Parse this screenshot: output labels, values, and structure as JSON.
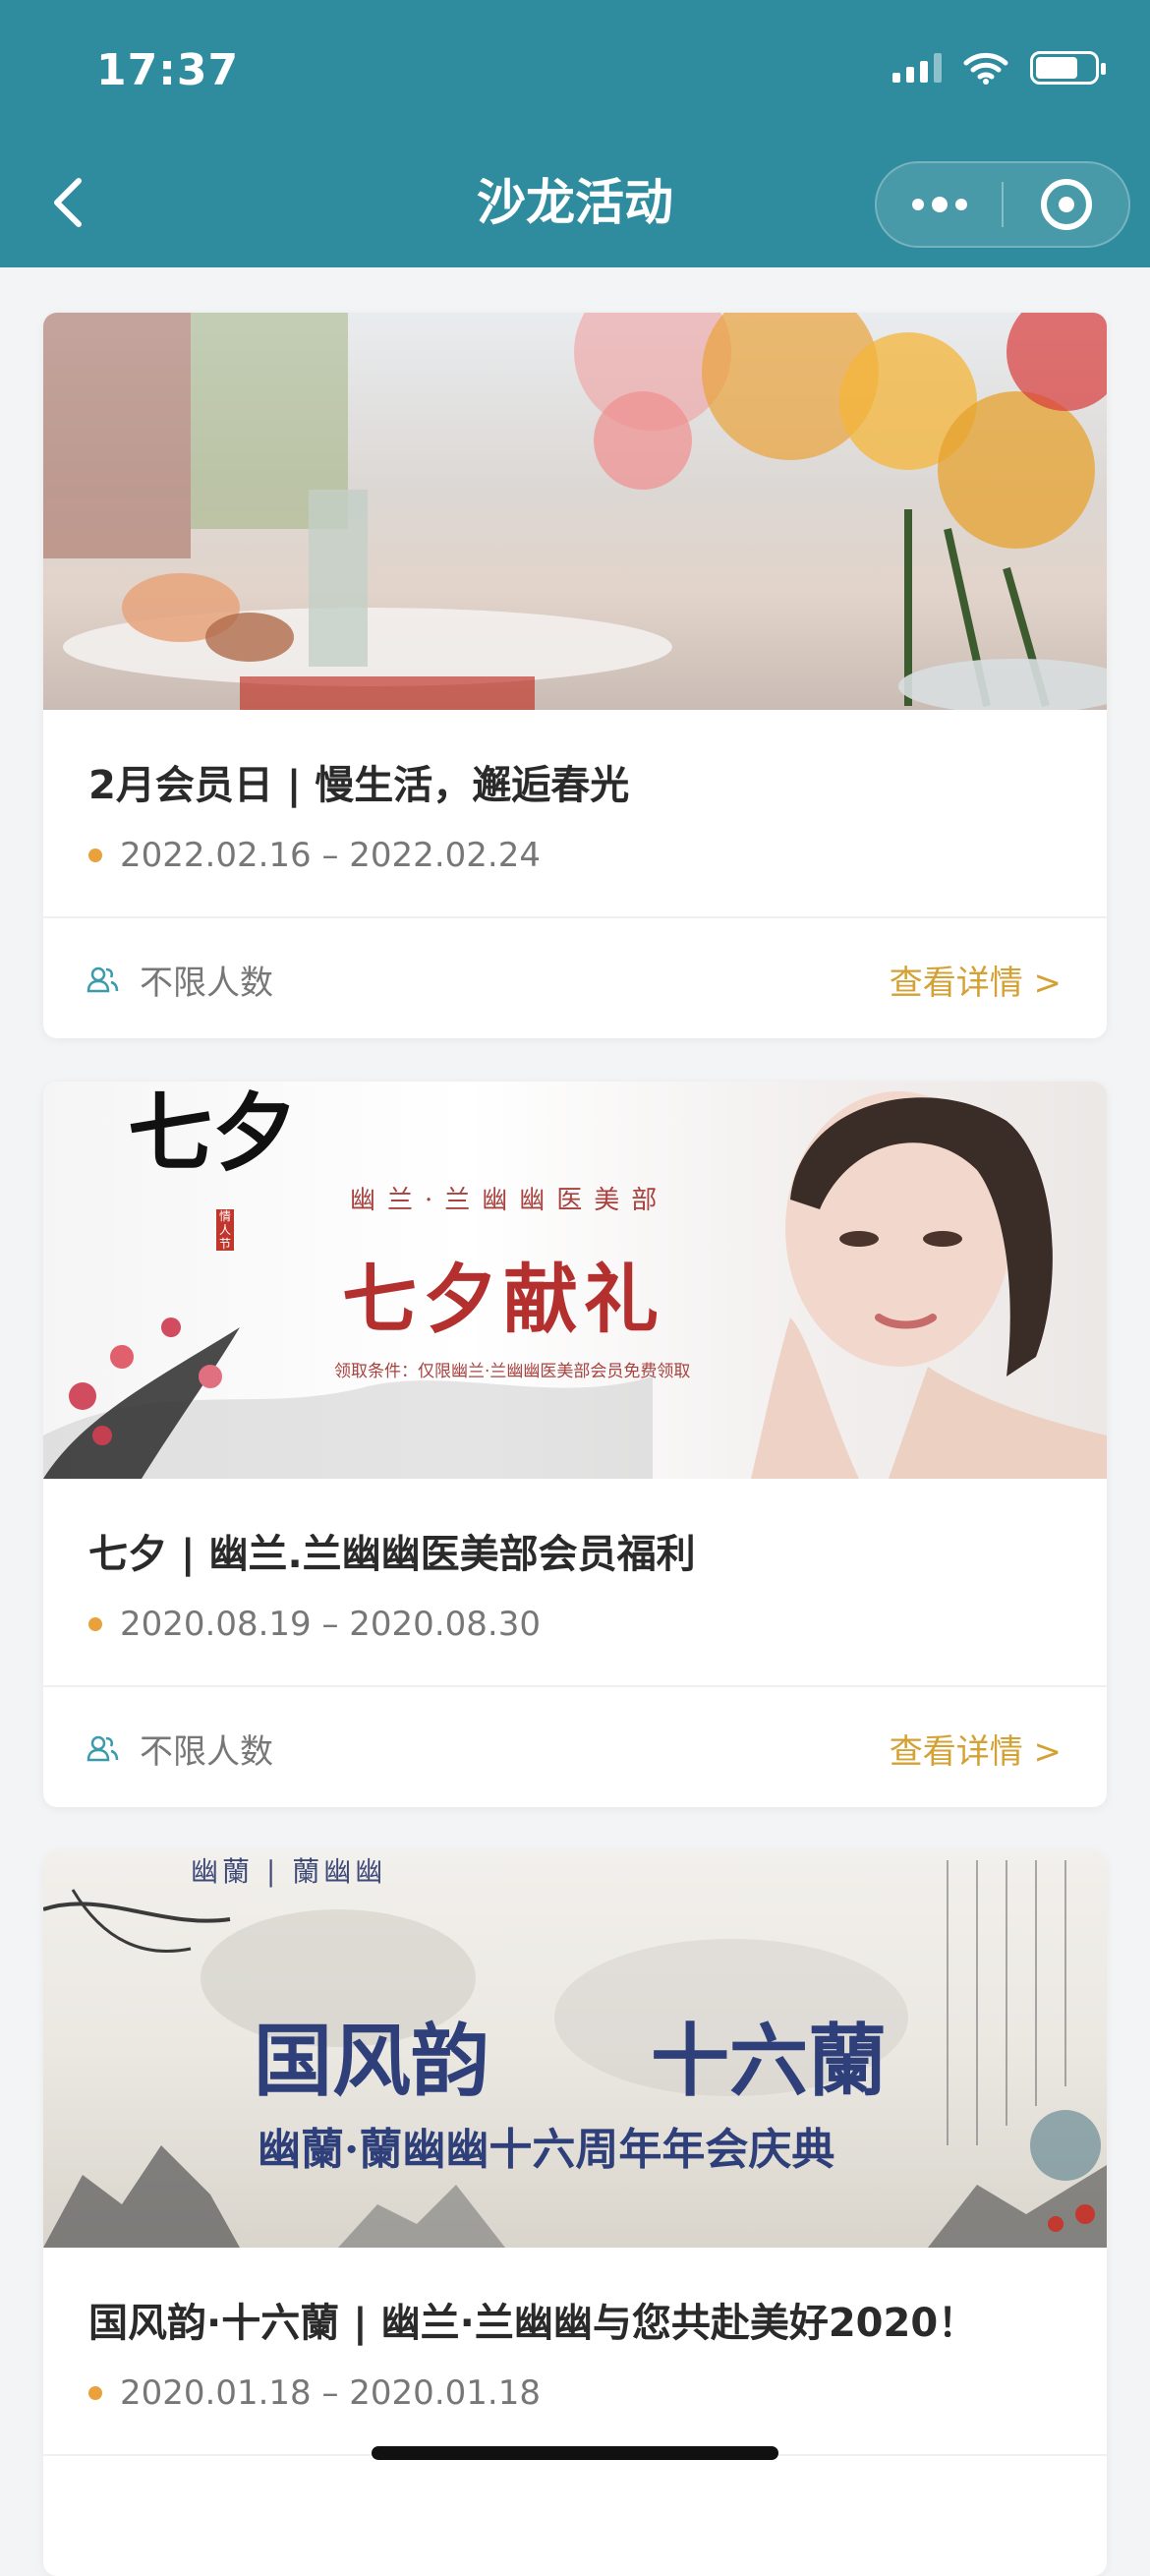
{
  "status_bar": {
    "time": "17:37"
  },
  "nav": {
    "title": "沙龙活动"
  },
  "cards": [
    {
      "title": "2月会员日 | 慢生活，邂逅春光",
      "date": "2022.02.16 – 2022.02.24",
      "limit": "不限人数",
      "detail": "查看详情 >"
    },
    {
      "title": "七夕 | 幽兰.兰幽幽医美部会员福利",
      "date": "2020.08.19 – 2020.08.30",
      "limit": "不限人数",
      "detail": "查看详情 >",
      "banner": {
        "logo_text": "七夕",
        "seal_text": "情人节",
        "brand": "幽兰·兰幽幽医美部",
        "headline": "七夕献礼",
        "condition": "领取条件：仅限幽兰·兰幽幽医美部会员免费领取"
      }
    },
    {
      "title": "国风韵·十六蘭 | 幽兰·兰幽幽与您共赴美好2020！",
      "date": "2020.01.18 – 2020.01.18",
      "banner": {
        "top_logo": "幽蘭 | 蘭幽幽",
        "headline_left": "国风韵",
        "headline_right": "十六蘭",
        "subline": "幽蘭·蘭幽幽十六周年年会庆典"
      }
    }
  ],
  "colors": {
    "header": "#2f8c9e",
    "accent": "#d4a134",
    "dot": "#e8a13b"
  }
}
